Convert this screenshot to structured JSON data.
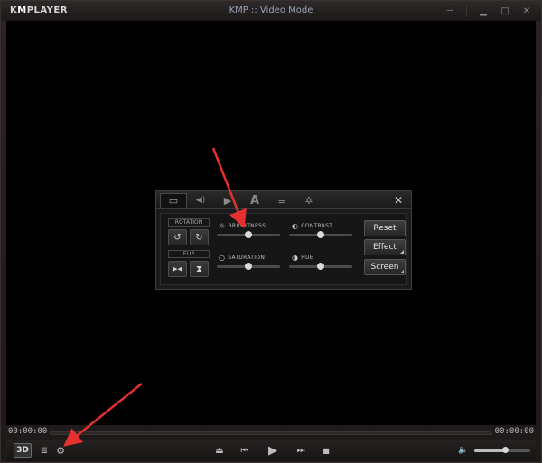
{
  "app": {
    "logo_left": "K",
    "logo_mid": "M",
    "logo_right": "PLAYER",
    "title": "KMP :: Video Mode"
  },
  "window_controls": [
    {
      "name": "pin",
      "glyph": "⊣"
    },
    {
      "name": "minimize",
      "glyph": "▁"
    },
    {
      "name": "maximize",
      "glyph": "□"
    },
    {
      "name": "close",
      "glyph": "✕"
    }
  ],
  "timeline": {
    "elapsed": "00:00:00",
    "total": "00:00:00",
    "position": 0
  },
  "controls": {
    "btn_3d": "3D",
    "playlist_icon": "≣",
    "settings_icon": "⚙",
    "eject_icon": "⏏",
    "prev_icon": "⏮",
    "play_icon": "▶",
    "next_icon": "⏭",
    "stop_icon": "■",
    "volume_icon": "🔈",
    "volume": 0.55
  },
  "panel": {
    "tabs": [
      {
        "name": "screen",
        "glyph": "▭",
        "active": true
      },
      {
        "name": "audio",
        "glyph": "◀)"
      },
      {
        "name": "playback",
        "glyph": "▶"
      },
      {
        "name": "subtitle",
        "glyph": "A"
      },
      {
        "name": "playlist",
        "glyph": "≡"
      },
      {
        "name": "settings",
        "glyph": "✲"
      }
    ],
    "close_glyph": "✕",
    "rotation_label": "ROTATION",
    "flip_label": "FLIP",
    "rotate_ccw": "↺",
    "rotate_cw": "↻",
    "flip_h": "▶◀",
    "flip_v": "⧗",
    "sliders": {
      "brightness": {
        "label": "BRIGHTNESS",
        "icon": "☼",
        "value": 0.5
      },
      "contrast": {
        "label": "CONTRAST",
        "icon": "◐",
        "value": 0.5
      },
      "saturation": {
        "label": "SATURATION",
        "icon": "○",
        "value": 0.5
      },
      "hue": {
        "label": "HUE",
        "icon": "◑",
        "value": 0.5
      }
    },
    "buttons": {
      "reset": "Reset",
      "effect": "Effect",
      "screen": "Screen"
    }
  },
  "colors": {
    "annotation_arrow": "#e53030",
    "title_text": "#9aa3b5"
  }
}
